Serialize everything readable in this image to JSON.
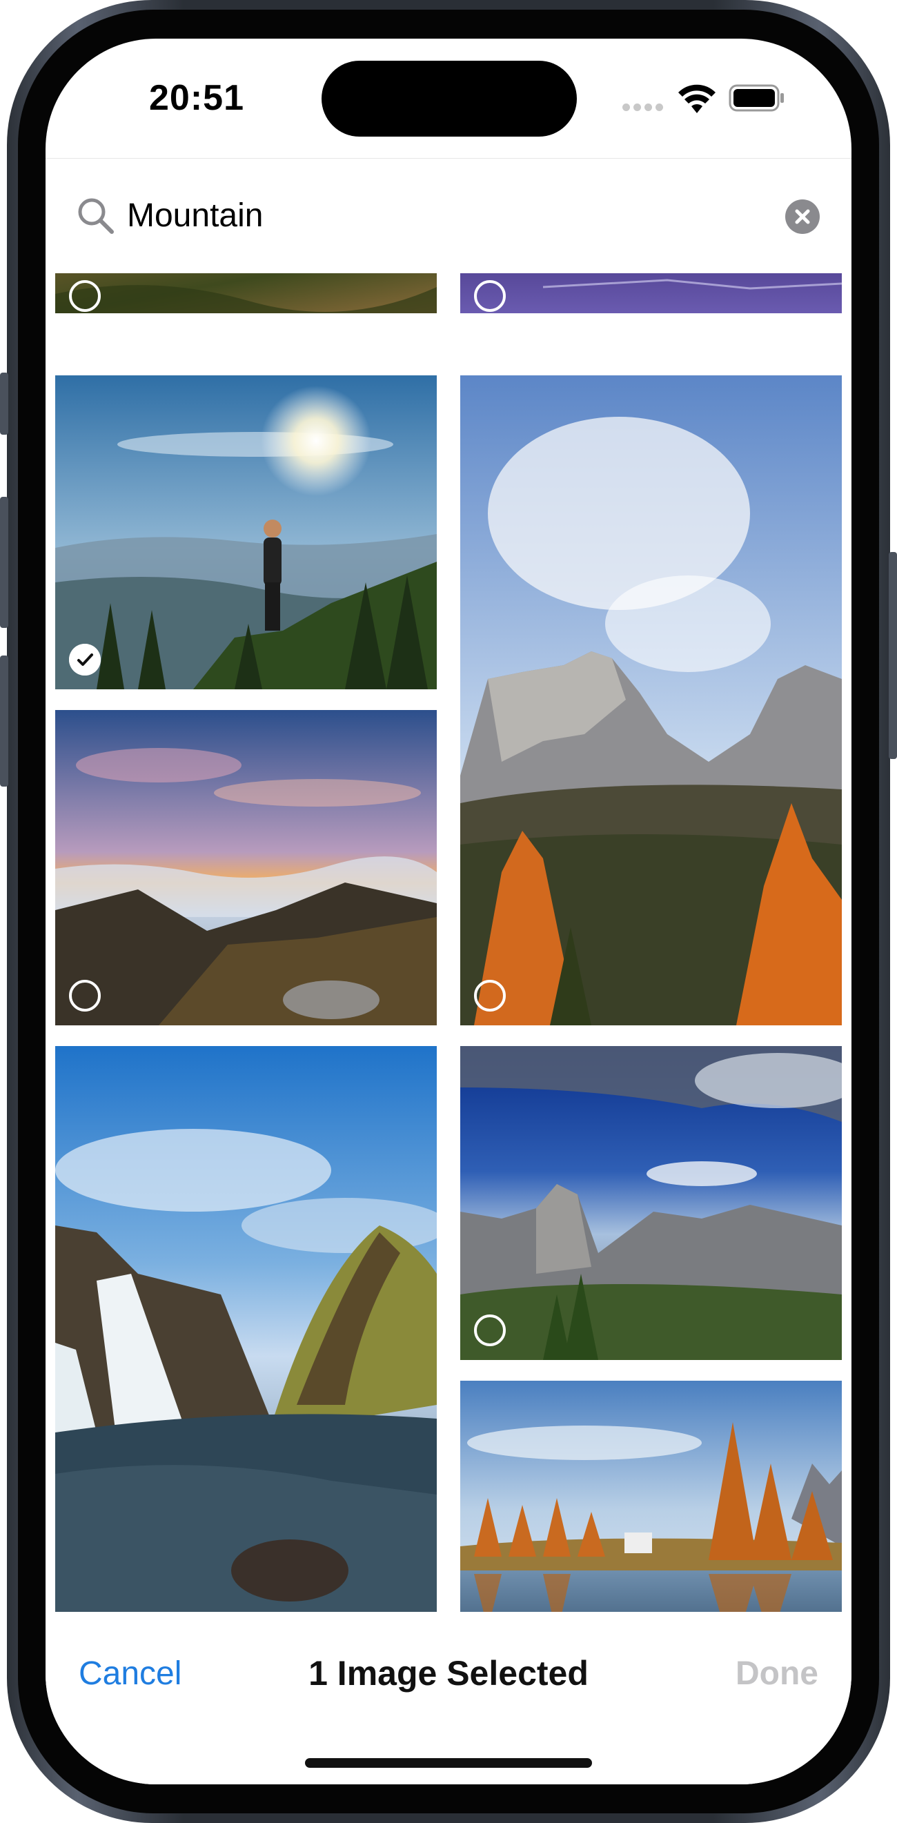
{
  "status_bar": {
    "time": "20:51"
  },
  "search": {
    "query": "Mountain"
  },
  "bottom_bar": {
    "cancel_label": "Cancel",
    "title": "1 Image Selected",
    "done_label": "Done"
  },
  "colors": {
    "accent": "#1f7de0",
    "done_disabled": "#c4c4c6",
    "clear_button": "#8a8a8e"
  },
  "photos": [
    {
      "name": "forest-partial-top",
      "selected": false
    },
    {
      "name": "purple-partial-top",
      "selected": false
    },
    {
      "name": "hiker-sun",
      "selected": true
    },
    {
      "name": "dolomites-autumn",
      "selected": false
    },
    {
      "name": "sunset-clouds",
      "selected": false
    },
    {
      "name": "waterfall-hill",
      "selected": false
    },
    {
      "name": "valley-half-dome",
      "selected": false
    },
    {
      "name": "lake-autumn-trees",
      "selected": false
    }
  ]
}
